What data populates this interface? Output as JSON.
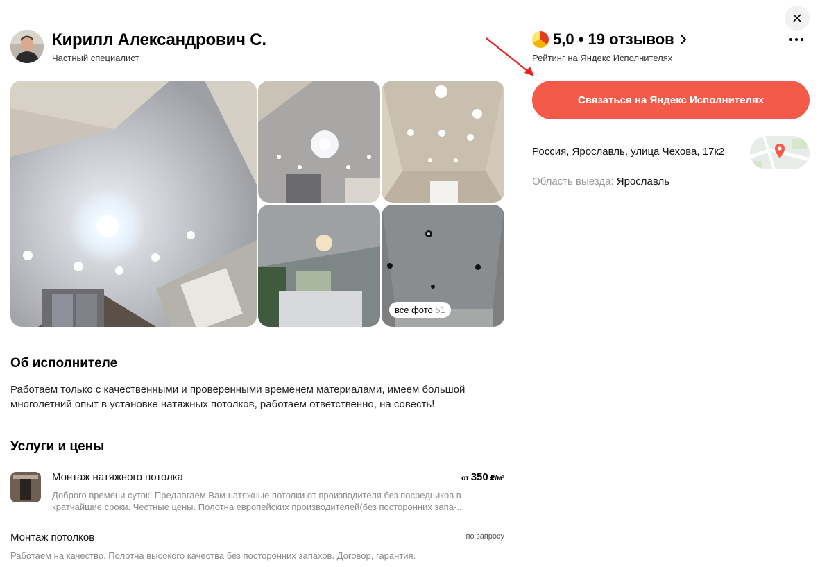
{
  "profile": {
    "name": "Кирилл Александрович С.",
    "role": "Частный специалист"
  },
  "gallery": {
    "all_photos_label": "все фото",
    "all_photos_count": "51"
  },
  "about": {
    "title": "Об исполнителе",
    "text": "Работаем только с качественными и проверенными временем материалами, имеем большой многолетний опыт в установке натяжных потолков, работаем ответственно, на совесть!"
  },
  "services": {
    "title": "Услуги и цены",
    "items": [
      {
        "name": "Монтаж натяжного потолка",
        "price_prefix": "от",
        "price_value": "350",
        "price_unit": "₽/м²",
        "description": "Доброго времени суток! Предлагаем Вам натяжные потолки от производителя без посредников в кратчайшие сроки. Честные цены. Полотна европейских производителей(без посторонних запа-..."
      },
      {
        "name": "Монтаж потолков",
        "price": "по запросу",
        "description": "Работаем на качество. Полотна высокого качества без посторонних запахов. Договор, гарантия."
      }
    ]
  },
  "rating": {
    "text": "5,0 • 19 отзывов",
    "caption": "Рейтинг на Яндекс Исполнителях"
  },
  "contact_button": "Связаться на Яндекс Исполнителях",
  "location": {
    "address": "Россия, Ярославль, улица Чехова, 17к2",
    "area_label": "Область выезда:",
    "area_value": "Ярославль"
  },
  "colors": {
    "accent": "#f45a4a",
    "annotation_arrow": "#e8221e"
  },
  "icons": [
    "close-icon",
    "chevron-right-icon",
    "more-icon",
    "map-pin-icon",
    "rating-icon"
  ]
}
